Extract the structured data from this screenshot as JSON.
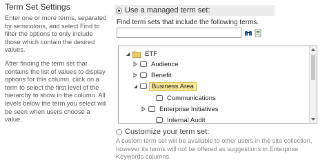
{
  "section": {
    "title": "Term Set Settings",
    "help_paragraphs": [
      "Enter one or more terms, separated by semicolons, and select Find to filter the options to only include those which contain the desired values.",
      "After finding the term set that contains the list of values to display options for this column, click on a term to select the first level of the hierarchy to show in the column. All levels below the term you select will be seen when users choose a value."
    ]
  },
  "managed": {
    "radio_label": "Use a managed term set:",
    "selected": true,
    "find_label": "Find term sets that include the following terms.",
    "search_value": "",
    "find_icon": "binoculars-icon",
    "browse_icon": "term-store-browse-icon"
  },
  "tree": {
    "nodes": [
      {
        "label": "ETF",
        "expander": "expanded"
      },
      {
        "label": "Audience",
        "expander": "collapsed"
      },
      {
        "label": "Benefit",
        "expander": "collapsed"
      },
      {
        "label": "Business Area",
        "expander": "expanded",
        "selected": true
      },
      {
        "label": "Communications",
        "expander": "none"
      },
      {
        "label": "Enterprise Initiatives",
        "expander": "collapsed"
      },
      {
        "label": "Internal Audit",
        "expander": "none"
      }
    ]
  },
  "custom": {
    "radio_label": "Customize your term set:",
    "selected": false,
    "help": "A custom term set will be available to other users in the site collection, however its terms will not be offered as suggestions in Enterprise Keywords columns."
  }
}
